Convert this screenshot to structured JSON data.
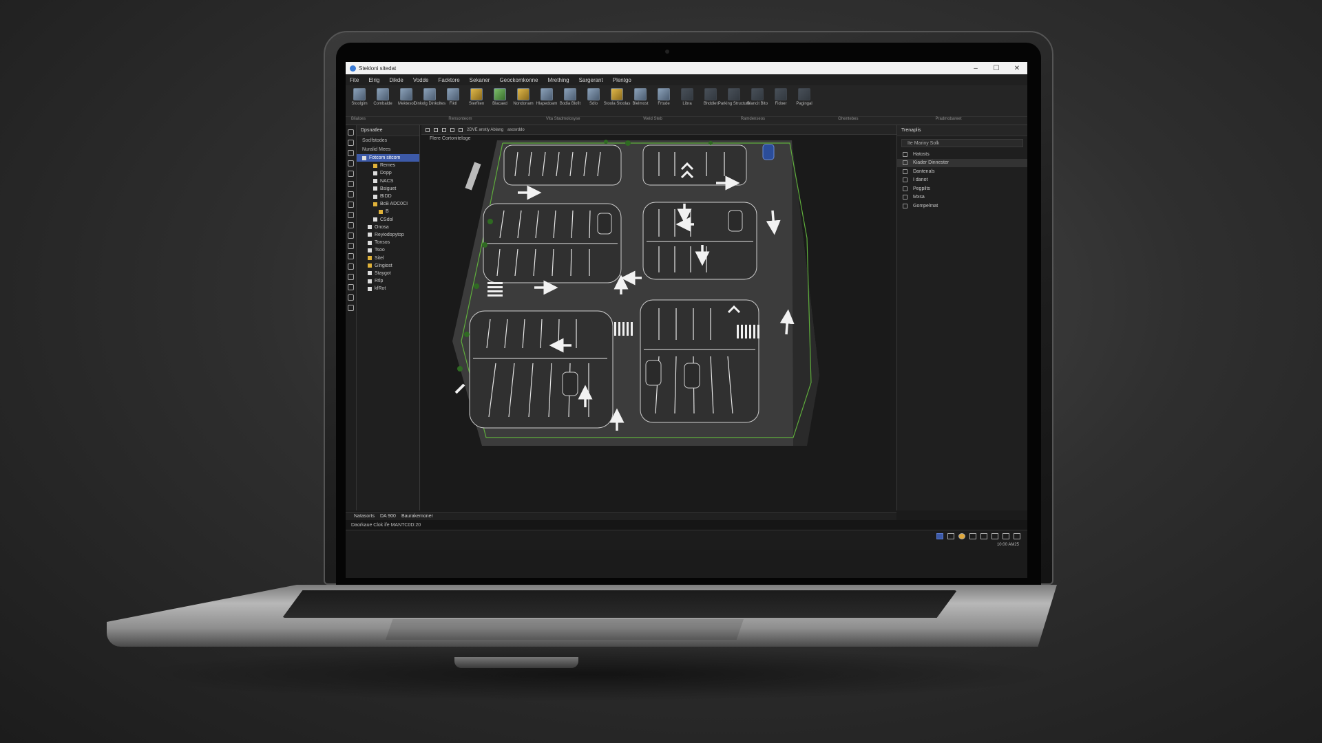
{
  "window": {
    "title": "Stekloni sitedat"
  },
  "menu": [
    "Fite",
    "Elrig",
    "Dikde",
    "Vodde",
    "Facktore",
    "Sekaner",
    "Geockomkonne",
    "Mrething",
    "Sargerant",
    "Plentgo"
  ],
  "ribbon": {
    "buttons": [
      {
        "label": "Stoolgim",
        "icon": "draw-icon",
        "tone": ""
      },
      {
        "label": "Combalde",
        "icon": "layer-icon",
        "tone": ""
      },
      {
        "label": "Mektesol",
        "icon": "network-icon",
        "tone": ""
      },
      {
        "label": "Dinkolg Dinkoltes",
        "icon": "rotate-icon",
        "tone": ""
      },
      {
        "label": "Fiktl",
        "icon": "pin-icon",
        "tone": ""
      },
      {
        "label": "Sterfiten",
        "icon": "brush-icon",
        "tone": "warn"
      },
      {
        "label": "Blacaed",
        "icon": "block-icon",
        "tone": "green"
      },
      {
        "label": "Nondonam",
        "icon": "folder-icon",
        "tone": "warn"
      },
      {
        "label": "Hlapedoam",
        "icon": "layout-icon",
        "tone": ""
      },
      {
        "label": "Bodia Blofit",
        "icon": "sheet-icon",
        "tone": ""
      },
      {
        "label": "Sdlo",
        "icon": "table-icon",
        "tone": ""
      },
      {
        "label": "Stoola Stoolas",
        "icon": "grid-icon",
        "tone": "warn"
      },
      {
        "label": "Blelmost",
        "icon": "doc-icon",
        "tone": ""
      },
      {
        "label": "Frtude",
        "icon": "export-icon",
        "tone": ""
      },
      {
        "label": "Libra",
        "icon": "lib-icon",
        "tone": "dim"
      },
      {
        "label": "Bhddlet",
        "icon": "panel-icon",
        "tone": "dim"
      },
      {
        "label": "Parking Structure",
        "icon": "parking-icon",
        "tone": "dim"
      },
      {
        "label": "Blancit Blto",
        "icon": "blank-icon",
        "tone": "dim"
      },
      {
        "label": "Fidoer",
        "icon": "user-icon",
        "tone": "dim"
      },
      {
        "label": "Pagingal",
        "icon": "page-icon",
        "tone": "dim"
      }
    ],
    "groups": [
      "Blialoes",
      "Rensonteom",
      "Vita Stadmolosyse",
      "Weld Steb",
      "Ramdenseos",
      "Ghentebes",
      "Pradmobareet"
    ]
  },
  "tree": {
    "header": "Dpsnatlee",
    "sub": "Soclfstodes",
    "group": "Nuralid Mees",
    "items": [
      {
        "label": "Fotcom sitcom",
        "indent": 0,
        "color": "",
        "selected": true
      },
      {
        "label": "Remes",
        "indent": 2,
        "color": "y",
        "selected": false
      },
      {
        "label": "Dopp",
        "indent": 2,
        "color": "",
        "selected": false
      },
      {
        "label": "NACS",
        "indent": 2,
        "color": "",
        "selected": false
      },
      {
        "label": "Bsiguet",
        "indent": 2,
        "color": "",
        "selected": false
      },
      {
        "label": "BIDD",
        "indent": 2,
        "color": "",
        "selected": false
      },
      {
        "label": "BcB ADC0CI",
        "indent": 2,
        "color": "y",
        "selected": false
      },
      {
        "label": "B",
        "indent": 3,
        "color": "y",
        "selected": false
      },
      {
        "label": "CSdol",
        "indent": 2,
        "color": "",
        "selected": false
      },
      {
        "label": "Onosa",
        "indent": 1,
        "color": "",
        "selected": false
      },
      {
        "label": "Reyiodopytop",
        "indent": 1,
        "color": "",
        "selected": false
      },
      {
        "label": "Tonsos",
        "indent": 1,
        "color": "",
        "selected": false
      },
      {
        "label": "Tsoo",
        "indent": 1,
        "color": "",
        "selected": false
      },
      {
        "label": "Sitel",
        "indent": 1,
        "color": "y",
        "selected": false
      },
      {
        "label": "Glngiost",
        "indent": 1,
        "color": "y",
        "selected": false
      },
      {
        "label": "Staygot",
        "indent": 1,
        "color": "",
        "selected": false
      },
      {
        "label": "Rtlp",
        "indent": 1,
        "color": "",
        "selected": false
      },
      {
        "label": "kfRot",
        "indent": 1,
        "color": "",
        "selected": false
      }
    ]
  },
  "canvas": {
    "toolbar_text": "2DVE  anstly  Ablang",
    "layer_select": "asosrddo",
    "label": "Flere Cortoniteloge",
    "scale_label": "DA 900",
    "bottom_label": "Baurakemoner"
  },
  "props": {
    "header": "Trenaplis",
    "search": "Ite Mariny Solk",
    "rows": [
      "Hatosts",
      "Kiader Dinnester",
      "Dantenals",
      "I danot",
      "Pegpilts",
      "Mxsa",
      "Gompelmat"
    ]
  },
  "bottom": {
    "tab": "Natasorts",
    "cmd": "Daorkaue Clok ife MANTC0D:20"
  },
  "status": {
    "time": "10:00",
    "date": "AM25"
  },
  "colors": {
    "accent": "#3d5aa8",
    "plan_line": "#5fae3c",
    "plan_fill": "#2d2d2d",
    "ground": "#3a3a3a"
  }
}
